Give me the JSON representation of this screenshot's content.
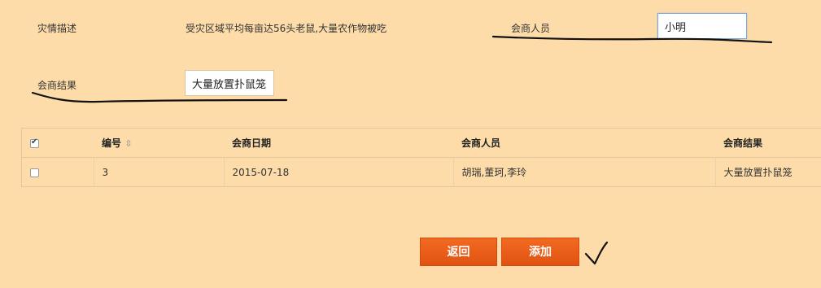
{
  "form": {
    "disaster_label": "灾情描述",
    "disaster_text": "受灾区域平均每亩达56头老鼠,大量农作物被吃",
    "members_label": "会商人员",
    "members_value": "小明",
    "result_label": "会商结果",
    "result_value": "大量放置扑鼠笼"
  },
  "table": {
    "headers": {
      "id": "编号",
      "sort_icon": "⇳",
      "date": "会商日期",
      "members": "会商人员",
      "result": "会商结果"
    },
    "rows": [
      {
        "id": "3",
        "date": "2015-07-18",
        "members": "胡瑞,董珂,李玲",
        "result": "大量放置扑鼠笼"
      }
    ]
  },
  "buttons": {
    "back": "返回",
    "add": "添加"
  }
}
